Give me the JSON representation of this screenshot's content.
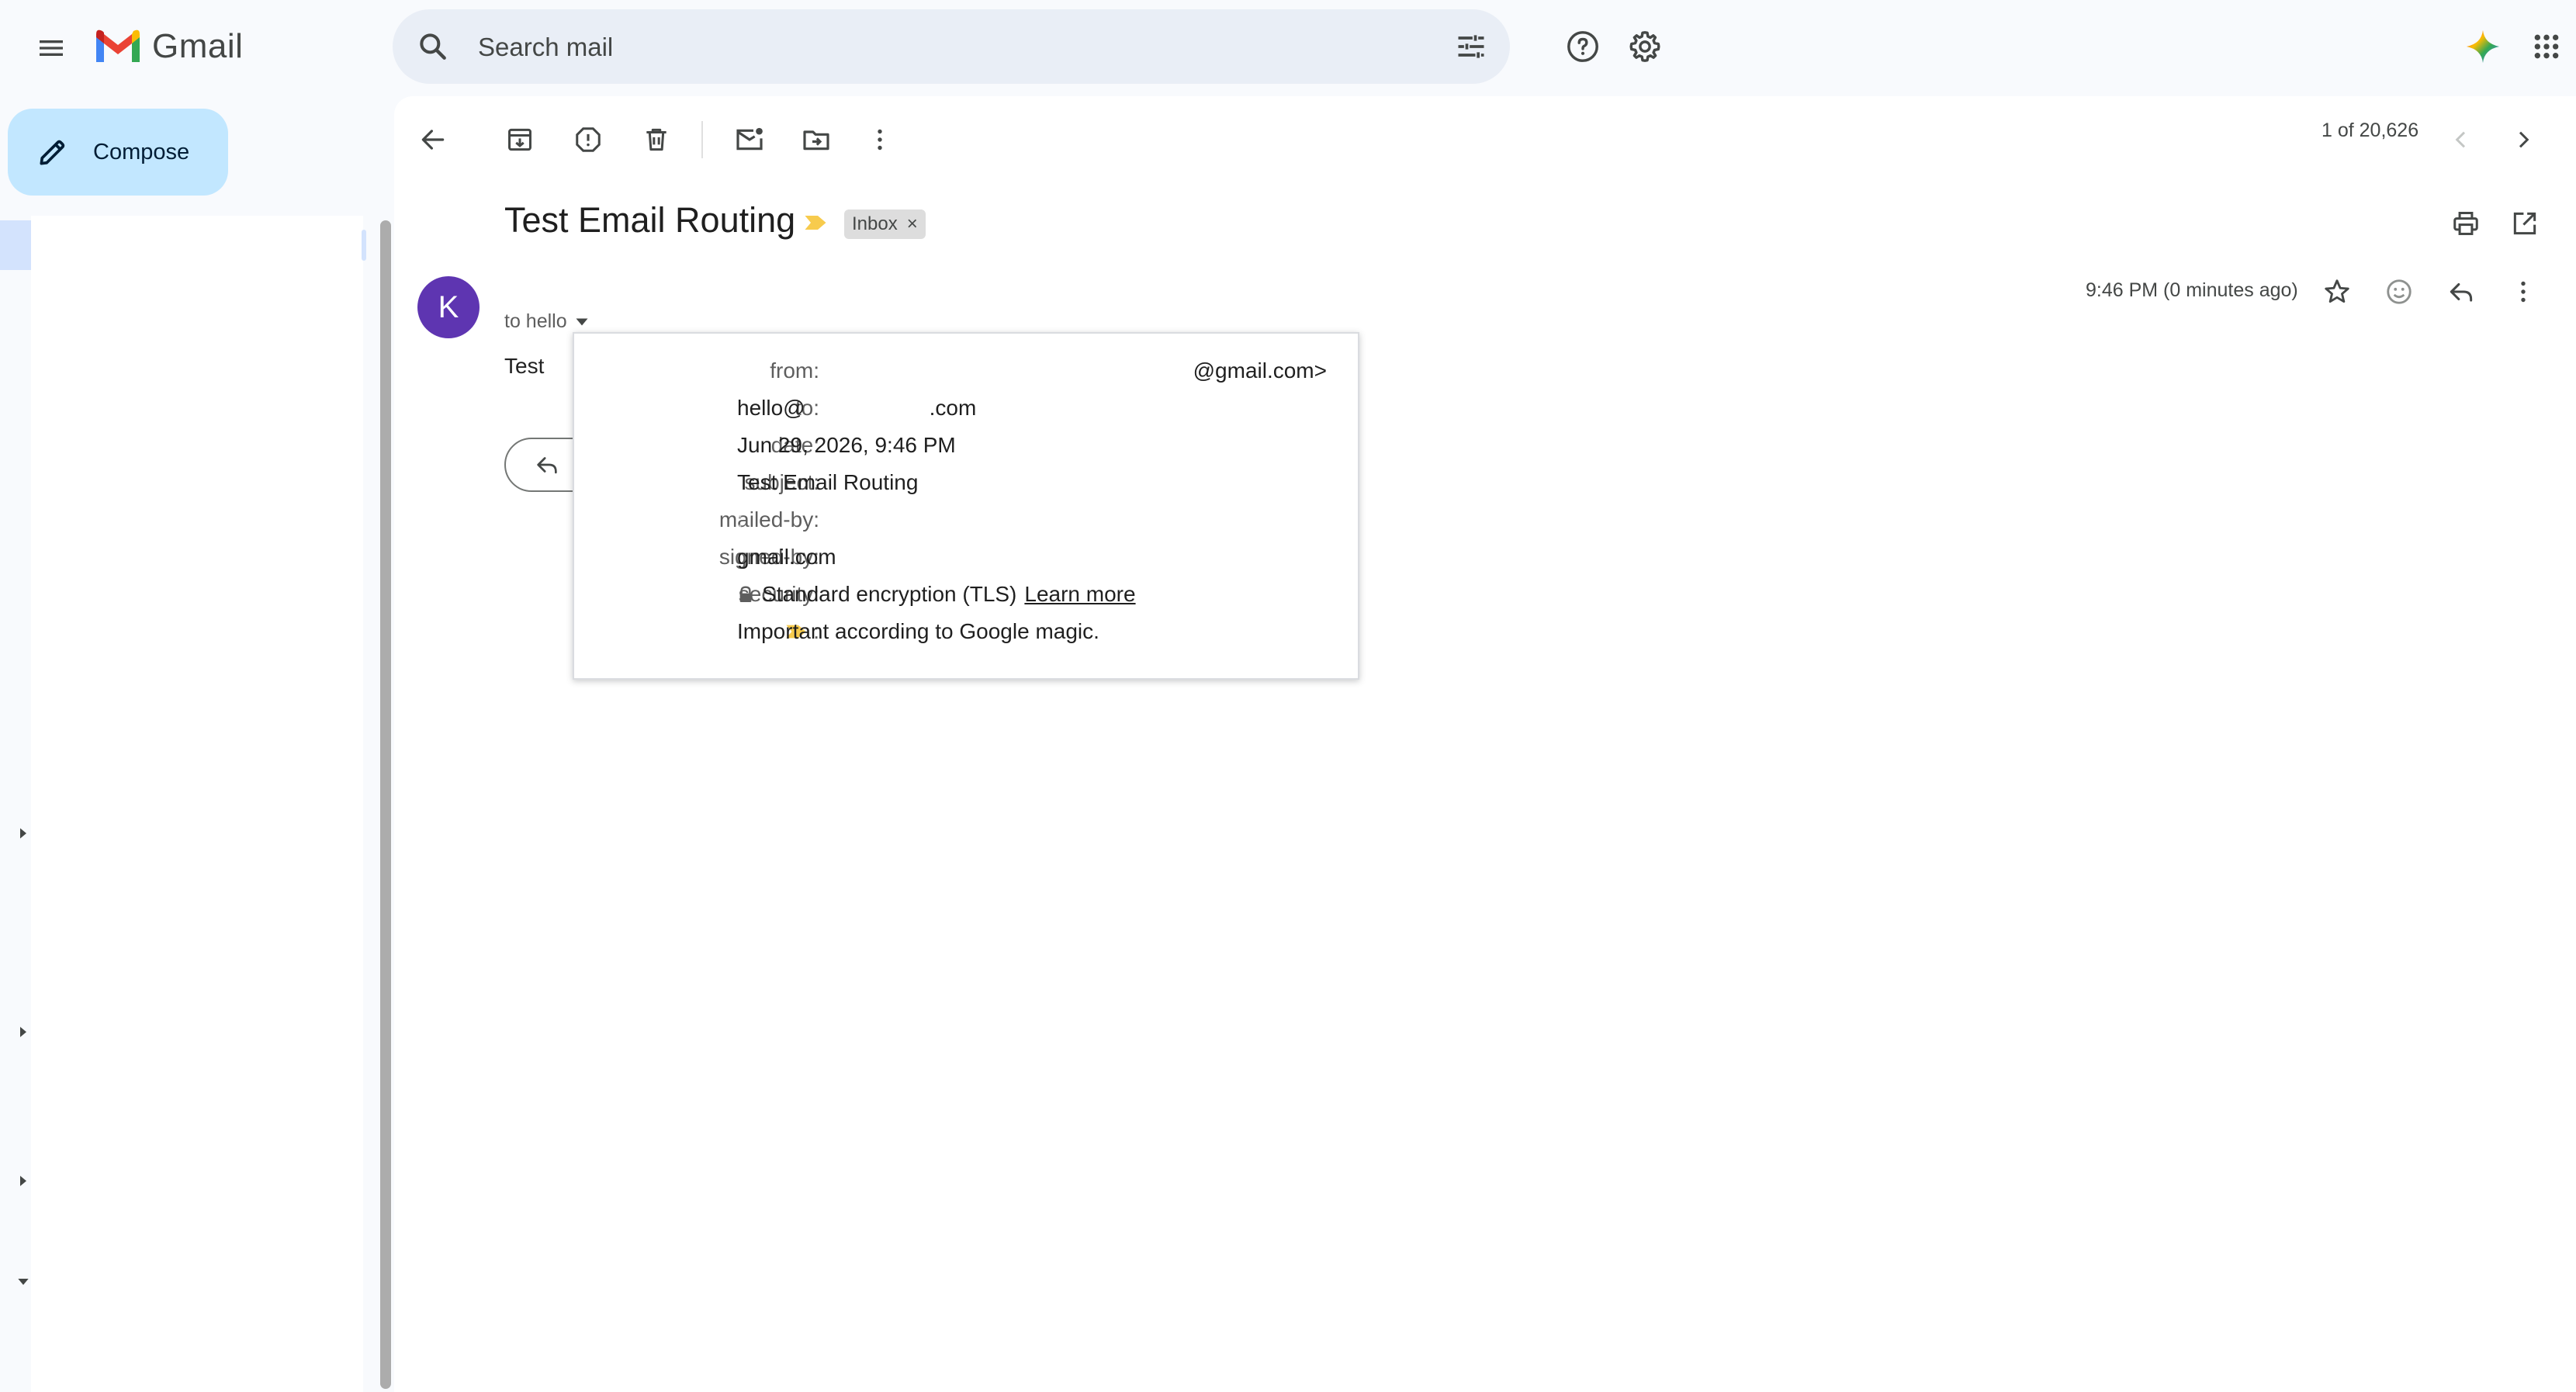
{
  "app": {
    "name": "Gmail"
  },
  "search": {
    "placeholder": "Search mail"
  },
  "nav": {
    "compose_label": "Compose"
  },
  "toolbar": {
    "pagination": "1 of 20,626"
  },
  "email": {
    "subject": "Test Email Routing",
    "label_chip": "Inbox",
    "label_remove": "×",
    "avatar_letter": "K",
    "to_summary": "to hello",
    "timestamp": "9:46 PM (0 minutes ago)",
    "body": "Test"
  },
  "details": {
    "from_label": "from:",
    "from_value": "@gmail.com>",
    "to_label": "to:",
    "to_value_prefix": "hello@",
    "to_value_suffix": ".com",
    "date_label": "date:",
    "date_value": "Jun 29, 2026, 9:46 PM",
    "subject_label": "subject:",
    "subject_value": "Test Email Routing",
    "mailed_by_label": "mailed-by:",
    "mailed_by_value": ":",
    "signed_by_label": "signed-by:",
    "signed_by_value": "gmail.com",
    "security_label": "security:",
    "security_value": "Standard encryption (TLS)",
    "security_link": "Learn more",
    "importance_label": ":",
    "importance_value": "Important according to Google magic."
  },
  "colors": {
    "accent_compose": "#c2e7ff",
    "avatar": "#5e35b1",
    "importance_marker": "#f7cb4d",
    "search_bg": "#e9eef6",
    "page_bg": "#f8fafd"
  },
  "icons": {
    "menu": "menu-icon",
    "search": "search-icon",
    "filters": "tune-icon",
    "help": "help-icon",
    "settings": "gear-icon",
    "gemini": "sparkle-icon",
    "apps": "apps-grid-icon",
    "compose": "pencil-icon",
    "back": "arrow-back-icon",
    "archive": "archive-icon",
    "spam": "report-spam-icon",
    "delete": "trash-icon",
    "mark_unread": "mark-unread-icon",
    "move": "move-to-folder-icon",
    "more": "more-vert-icon",
    "prev": "chevron-left-icon",
    "next": "chevron-right-icon",
    "print": "print-icon",
    "open_new": "open-in-new-icon",
    "star": "star-icon",
    "emoji": "emoji-icon",
    "reply": "reply-icon",
    "lock": "lock-icon"
  }
}
